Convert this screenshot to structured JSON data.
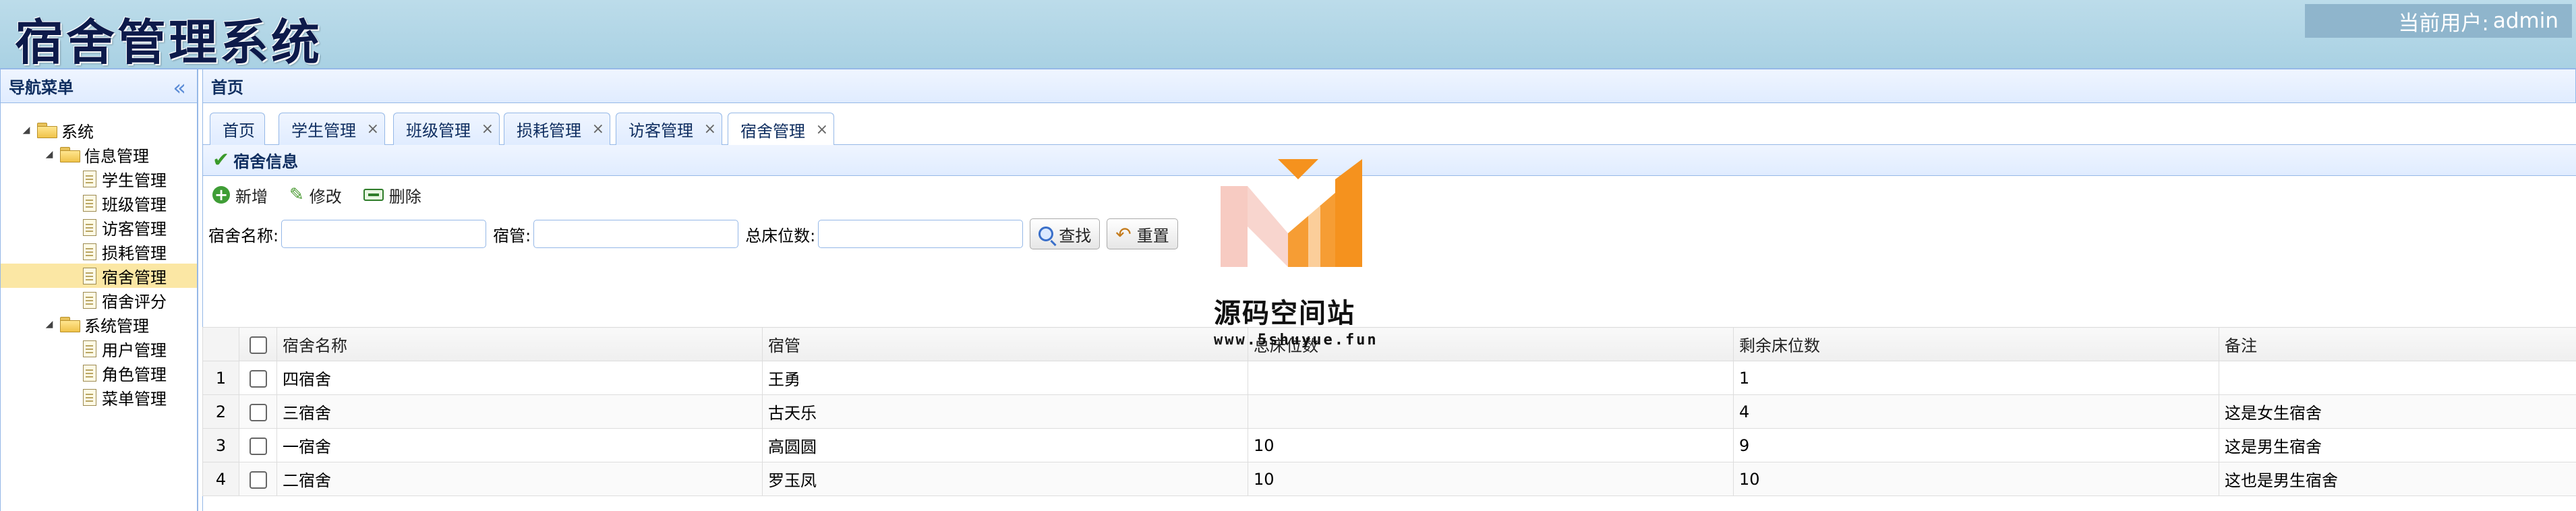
{
  "header": {
    "title": "宿舍管理系统",
    "user_label": "当前用户:",
    "user_name": "admin"
  },
  "west": {
    "title": "导航菜单",
    "tree": [
      {
        "label": "系统",
        "type": "folder",
        "level": 0,
        "expanded": true
      },
      {
        "label": "信息管理",
        "type": "folder",
        "level": 1,
        "expanded": true
      },
      {
        "label": "学生管理",
        "type": "file",
        "level": 2
      },
      {
        "label": "班级管理",
        "type": "file",
        "level": 2
      },
      {
        "label": "访客管理",
        "type": "file",
        "level": 2
      },
      {
        "label": "损耗管理",
        "type": "file",
        "level": 2
      },
      {
        "label": "宿舍管理",
        "type": "file",
        "level": 2,
        "selected": true
      },
      {
        "label": "宿舍评分",
        "type": "file",
        "level": 2
      },
      {
        "label": "系统管理",
        "type": "folder",
        "level": 1,
        "expanded": true
      },
      {
        "label": "用户管理",
        "type": "file",
        "level": 2
      },
      {
        "label": "角色管理",
        "type": "file",
        "level": 2
      },
      {
        "label": "菜单管理",
        "type": "file",
        "level": 2
      }
    ]
  },
  "center": {
    "title": "首页",
    "tabs": [
      {
        "label": "首页",
        "closable": false
      },
      {
        "label": "学生管理",
        "closable": true
      },
      {
        "label": "班级管理",
        "closable": true
      },
      {
        "label": "损耗管理",
        "closable": true
      },
      {
        "label": "访客管理",
        "closable": true
      },
      {
        "label": "宿舍管理",
        "closable": true,
        "active": true
      }
    ],
    "close_glyph": "×"
  },
  "panel": {
    "title": "宿舍信息",
    "toolbar": {
      "add": "新增",
      "edit": "修改",
      "delete": "删除"
    },
    "search": {
      "name_label": "宿舍名称:",
      "manager_label": "宿管:",
      "beds_label": "总床位数:",
      "search_button": "查找",
      "reset_button": "重置"
    }
  },
  "grid": {
    "columns": [
      "宿舍名称",
      "宿管",
      "总床位数",
      "剩余床位数",
      "备注"
    ],
    "rows": [
      {
        "num": "1",
        "name": "四宿舍",
        "manager": "王勇",
        "total": "",
        "remaining": "1",
        "note": ""
      },
      {
        "num": "2",
        "name": "三宿舍",
        "manager": "古天乐",
        "total": "",
        "remaining": "4",
        "note": "这是女生宿舍"
      },
      {
        "num": "3",
        "name": "一宿舍",
        "manager": "高圆圆",
        "total": "10",
        "remaining": "9",
        "note": "这是男生宿舍"
      },
      {
        "num": "4",
        "name": "二宿舍",
        "manager": "罗玉凤",
        "total": "10",
        "remaining": "10",
        "note": "这也是男生宿舍"
      }
    ]
  },
  "watermark": {
    "title": "源码空间站",
    "url": "www.5shuyue.fun",
    "colors": {
      "orange": "#f5921e",
      "pink": "#f4b9ae"
    }
  }
}
